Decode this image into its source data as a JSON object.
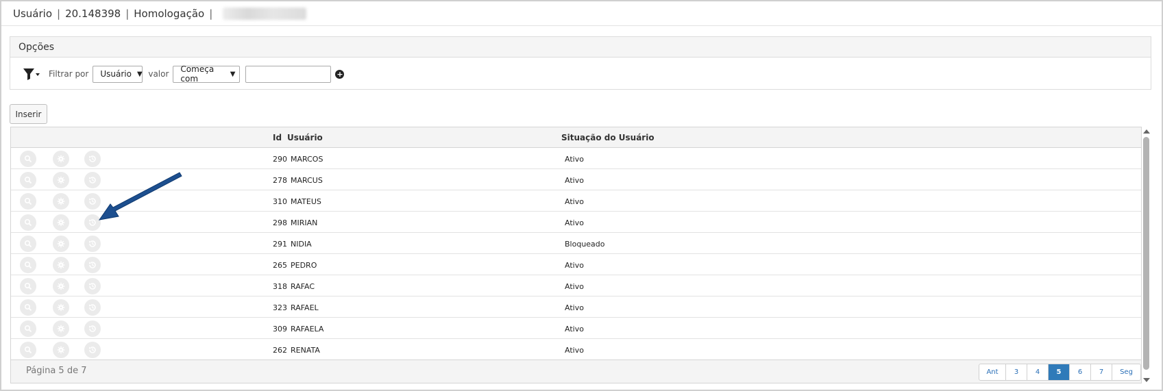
{
  "header": {
    "module": "Usuário",
    "version": "20.148398",
    "environment": "Homologação",
    "separator": "|"
  },
  "options": {
    "title": "Opções",
    "filter_by_label": "Filtrar por",
    "filter_field": "Usuário",
    "value_label": "valor",
    "filter_operator": "Começa com",
    "filter_value": ""
  },
  "toolbar": {
    "insert_label": "Inserir"
  },
  "table": {
    "columns": {
      "id": "Id",
      "user": "Usuário",
      "status": "Situação do Usuário"
    },
    "rows": [
      {
        "id": "290",
        "user": "MARCOS",
        "status": "Ativo"
      },
      {
        "id": "278",
        "user": "MARCUS",
        "status": "Ativo"
      },
      {
        "id": "310",
        "user": "MATEUS",
        "status": "Ativo"
      },
      {
        "id": "298",
        "user": "MIRIAN",
        "status": "Ativo"
      },
      {
        "id": "291",
        "user": "NIDIA",
        "status": "Bloqueado"
      },
      {
        "id": "265",
        "user": "PEDRO",
        "status": "Ativo"
      },
      {
        "id": "318",
        "user": "RAFAC",
        "status": "Ativo"
      },
      {
        "id": "323",
        "user": "RAFAEL",
        "status": "Ativo"
      },
      {
        "id": "309",
        "user": "RAFAELA",
        "status": "Ativo"
      },
      {
        "id": "262",
        "user": "RENATA",
        "status": "Ativo"
      }
    ],
    "row_icons": [
      "search-icon",
      "gear-icon",
      "history-icon"
    ]
  },
  "pagination": {
    "info": "Página 5 de 7",
    "prev": "Ant",
    "pages": [
      "3",
      "4",
      "5",
      "6",
      "7"
    ],
    "current": "5",
    "next": "Seg"
  },
  "colors": {
    "pager_active": "#2f7ab9",
    "annotation_arrow": "#1d4f8f"
  }
}
